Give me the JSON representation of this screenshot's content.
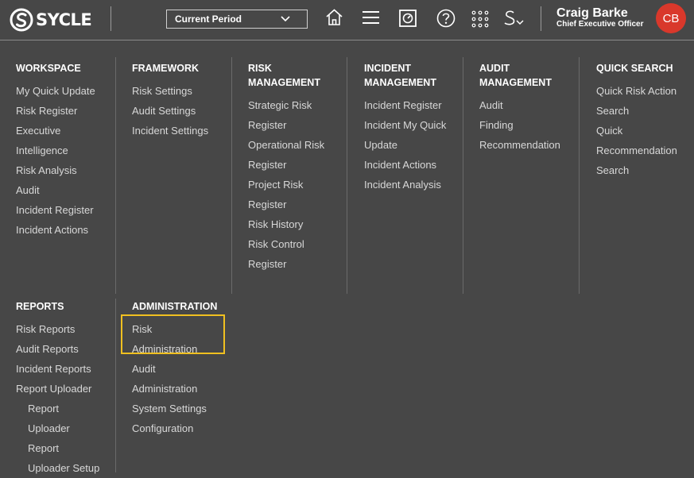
{
  "header": {
    "brand": "SYCLE",
    "period_select": "Current Period",
    "icons": [
      "home-icon",
      "menu-icon",
      "dashboard-icon",
      "help-icon",
      "apps-grid-icon",
      "sycle-switch-icon"
    ],
    "user_name": "Craig Barke",
    "user_role": "Chief Executive Officer",
    "avatar_initials": "CB",
    "avatar_color": "#d9382b"
  },
  "menu": {
    "workspace": {
      "title": "WORKSPACE",
      "items": [
        "My Quick Update",
        "Risk Register",
        "Executive",
        "Intelligence",
        "Risk Analysis",
        "Audit",
        "Incident Register",
        "Incident Actions"
      ]
    },
    "framework": {
      "title": "FRAMEWORK",
      "items": [
        "Risk Settings",
        "Audit Settings",
        "Incident Settings"
      ]
    },
    "risk_management": {
      "title_line1": "RISK",
      "title_line2": "MANAGEMENT",
      "items": [
        "Strategic Risk",
        "Register",
        "Operational Risk",
        "Register",
        "Project Risk",
        "Register",
        "Risk History",
        "Risk Control",
        "Register"
      ]
    },
    "incident_management": {
      "title_line1": "INCIDENT",
      "title_line2": "MANAGEMENT",
      "items": [
        "Incident Register",
        "Incident My Quick",
        "Update",
        "Incident Actions",
        "Incident Analysis"
      ]
    },
    "audit_management": {
      "title_line1": "AUDIT",
      "title_line2": "MANAGEMENT",
      "items": [
        "Audit",
        "Finding",
        "Recommendation"
      ]
    },
    "quick_search": {
      "title": "QUICK SEARCH",
      "items": [
        "Quick Risk Action",
        "Search",
        "Quick",
        "Recommendation",
        "Search"
      ]
    },
    "reports": {
      "title": "REPORTS",
      "items": [
        "Risk Reports",
        "Audit Reports",
        "Incident Reports",
        "Report Uploader"
      ],
      "sub_items": [
        "Report",
        "Uploader",
        "Report",
        "Uploader Setup"
      ]
    },
    "administration": {
      "title": "ADMINISTRATION",
      "items": [
        "Risk",
        "Administration",
        "Audit",
        "Administration",
        "System Settings",
        "Configuration"
      ]
    }
  },
  "highlight_color": "#f0c020"
}
